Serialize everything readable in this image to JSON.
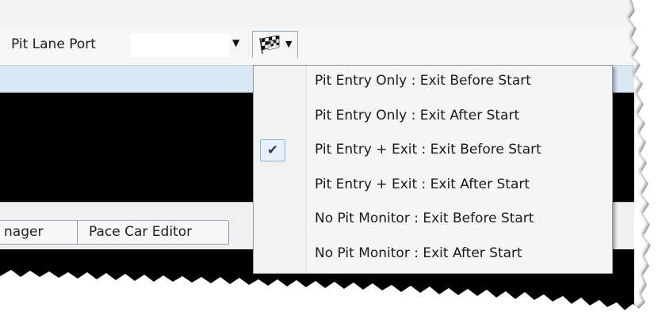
{
  "toolbar": {
    "label": "Pit Lane Port",
    "combo_arrow": "▼",
    "flag_arrow": "▼",
    "flag_icon": "checkered-flag-icon"
  },
  "tabs": [
    {
      "label": "nager"
    },
    {
      "label": "Pace Car Editor"
    }
  ],
  "menu": {
    "check_glyph": "✔",
    "items": [
      {
        "label": "Pit Entry Only : Exit Before Start",
        "checked": false
      },
      {
        "label": "Pit Entry Only : Exit After Start",
        "checked": false
      },
      {
        "label": "Pit Entry + Exit : Exit Before Start",
        "checked": true
      },
      {
        "label": "Pit Entry + Exit : Exit After Start",
        "checked": false
      },
      {
        "label": "No Pit Monitor : Exit Before Start",
        "checked": false
      },
      {
        "label": "No Pit Monitor : Exit After Start",
        "checked": false
      }
    ]
  },
  "colors": {
    "menu_background": "#f5f5f5",
    "highlight_band": "#dae7f5",
    "check_box_fill": "#e8f1fb",
    "check_box_border": "#89b7e6"
  }
}
